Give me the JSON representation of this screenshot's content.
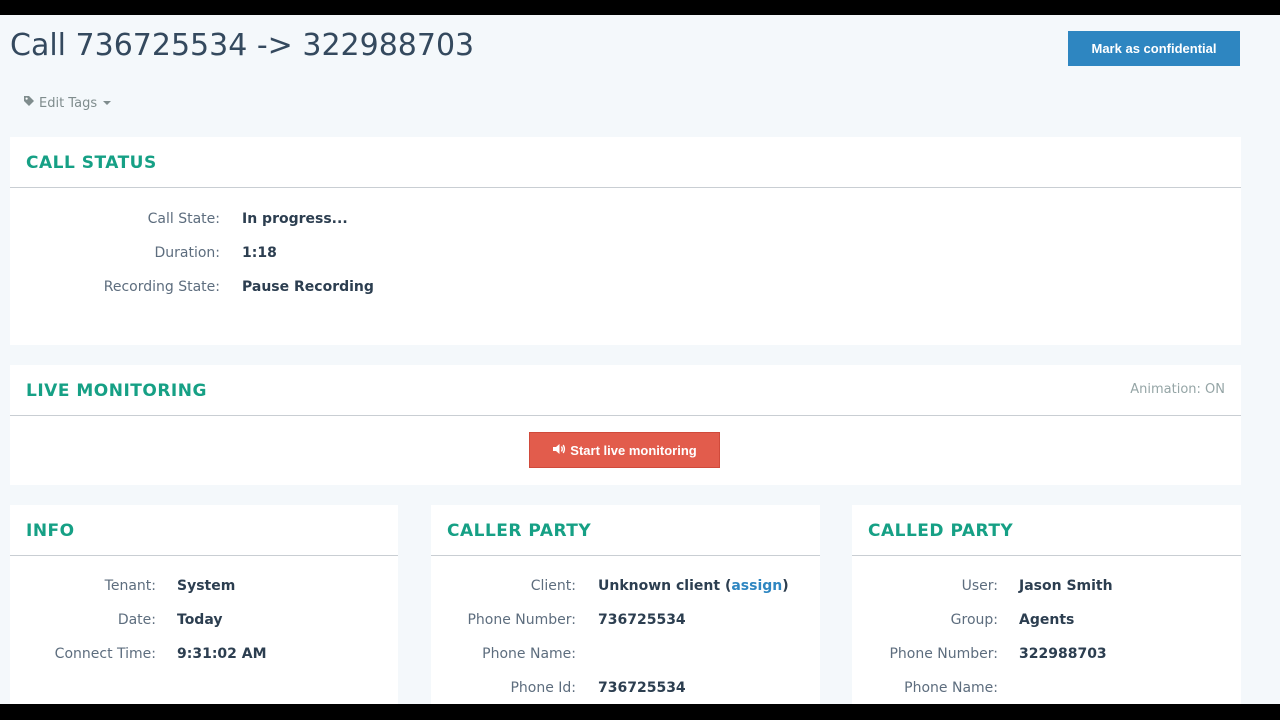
{
  "header": {
    "title": "Call 736725534 -> 322988703",
    "confidential_label": "Mark as confidential",
    "edit_tags_label": "Edit Tags"
  },
  "call_status": {
    "title": "CALL STATUS",
    "rows": [
      {
        "label": "Call State:",
        "value": "In progress..."
      },
      {
        "label": "Duration:",
        "value": "1:18"
      },
      {
        "label": "Recording State:",
        "value": "Pause Recording"
      }
    ]
  },
  "live_monitoring": {
    "title": "LIVE MONITORING",
    "animation_label": "Animation:",
    "animation_value": "ON",
    "start_label": "Start live monitoring"
  },
  "info": {
    "title": "INFO",
    "rows": [
      {
        "label": "Tenant:",
        "value": "System"
      },
      {
        "label": "Date:",
        "value": "Today"
      },
      {
        "label": "Connect Time:",
        "value": "9:31:02 AM"
      }
    ]
  },
  "caller_party": {
    "title": "CALLER PARTY",
    "client_label": "Client:",
    "client_value": "Unknown client",
    "assign_label": "assign",
    "rows": [
      {
        "label": "Phone Number:",
        "value": "736725534"
      },
      {
        "label": "Phone Name:",
        "value": ""
      },
      {
        "label": "Phone Id:",
        "value": "736725534"
      }
    ]
  },
  "called_party": {
    "title": "CALLED PARTY",
    "rows": [
      {
        "label": "User:",
        "value": "Jason Smith"
      },
      {
        "label": "Group:",
        "value": "Agents"
      },
      {
        "label": "Phone Number:",
        "value": "322988703"
      },
      {
        "label": "Phone Name:",
        "value": ""
      }
    ]
  },
  "colors": {
    "accent_teal": "#16a085",
    "link_blue": "#2e86c1",
    "danger_red": "#e25c4c"
  },
  "icons": {
    "tag": "tag-icon",
    "speaker": "volume-up-icon"
  }
}
